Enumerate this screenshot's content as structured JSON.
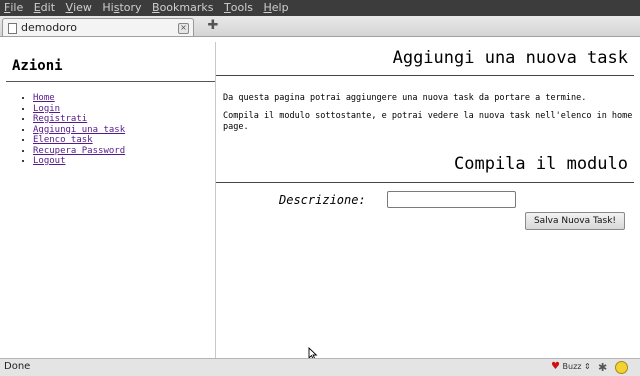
{
  "menu": {
    "items": [
      {
        "accel": "F",
        "rest": "ile"
      },
      {
        "accel": "E",
        "rest": "dit"
      },
      {
        "accel": "V",
        "rest": "iew"
      },
      {
        "accel": "",
        "pre": "Hi",
        "accel2": "s",
        "rest": "tory"
      },
      {
        "accel": "B",
        "rest": "ookmarks"
      },
      {
        "accel": "T",
        "rest": "ools"
      },
      {
        "accel": "H",
        "rest": "elp"
      }
    ]
  },
  "tab": {
    "title": "demodoro",
    "close_glyph": "×",
    "new_tab_glyph": "✚"
  },
  "sidebar": {
    "heading": "Azioni",
    "links": [
      "Home",
      "Login",
      "Registrati",
      "Aggiungi una task",
      "Elenco task",
      "Recupera Password",
      "Logout"
    ]
  },
  "main": {
    "title": "Aggiungi una nuova task",
    "intro1": "Da questa pagina potrai aggiungere una nuova task da portare a termine.",
    "intro2": "Compila il modulo sottostante, e potrai vedere la nuova task nell'elenco in home page.",
    "form_title": "Compila il modulo",
    "description_label": "Descrizione:",
    "description_value": "",
    "submit_label": "Salva Nuova Task!"
  },
  "status": {
    "text": "Done",
    "buzz_label": "Buzz",
    "buzz_arrow": "⇕"
  }
}
